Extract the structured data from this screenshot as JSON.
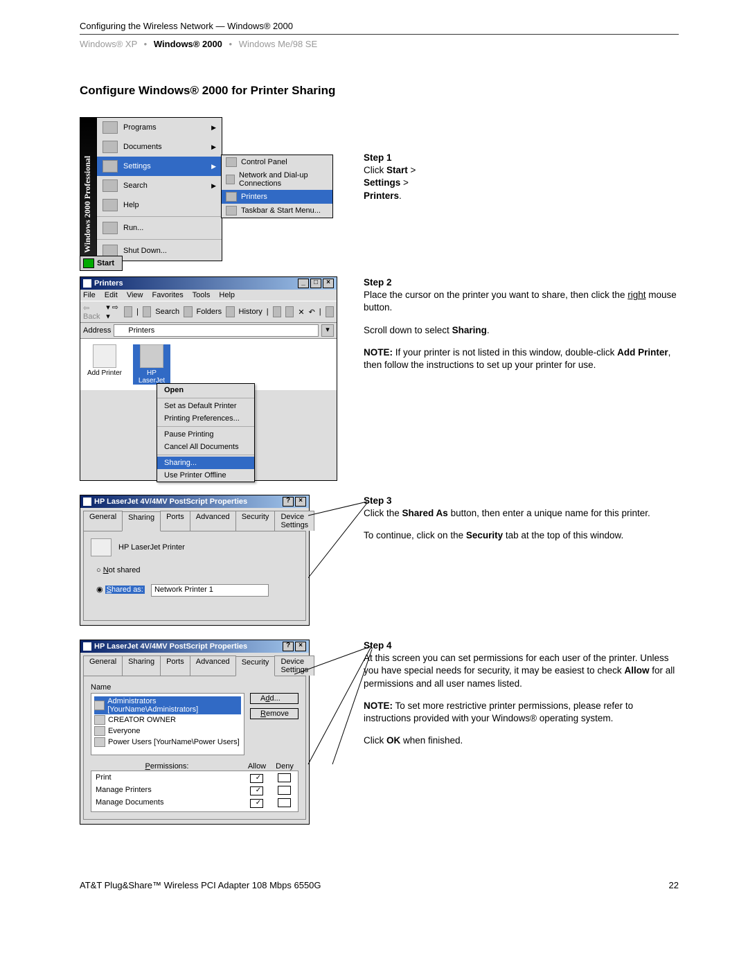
{
  "header": {
    "breadcrumb": "Configuring the Wireless Network — Windows® 2000",
    "tabs": {
      "xp": "Windows® XP",
      "w2000": "Windows® 2000",
      "me98": "Windows Me/98 SE"
    }
  },
  "title": "Configure Windows® 2000 for Printer Sharing",
  "start_menu": {
    "sidebar": "Windows 2000 Professional",
    "items": [
      "Programs",
      "Documents",
      "Settings",
      "Search",
      "Help",
      "Run...",
      "Shut Down..."
    ],
    "start_label": "Start",
    "submenu": [
      "Control Panel",
      "Network and Dial-up Connections",
      "Printers",
      "Taskbar & Start Menu..."
    ]
  },
  "step1": {
    "title": "Step 1",
    "click": "Click ",
    "start": "Start",
    "gt1": " > ",
    "settings": "Settings",
    "gt2": " > ",
    "printers": "Printers",
    "dot": "."
  },
  "printers_window": {
    "title": "Printers",
    "menus": [
      "File",
      "Edit",
      "View",
      "Favorites",
      "Tools",
      "Help"
    ],
    "toolbar": {
      "back": "Back",
      "search": "Search",
      "folders": "Folders",
      "history": "History"
    },
    "address_label": "Address",
    "address_value": "Printers",
    "icons": {
      "add": "Add Printer",
      "hp": "HP LaserJet"
    },
    "context": [
      "Open",
      "Set as Default Printer",
      "Printing Preferences...",
      "Pause Printing",
      "Cancel All Documents",
      "Sharing...",
      "Use Printer Offline"
    ]
  },
  "step2": {
    "title": "Step 2",
    "p1a": "Place the cursor on the printer you want to share, then click the ",
    "right": "right",
    "p1b": " mouse button.",
    "p2a": "Scroll down to select ",
    "sharing": "Sharing",
    "p2b": ".",
    "note_label": "NOTE:",
    "note_a": " If your printer is not listed in this window, double-click ",
    "addp": "Add Printer",
    "note_b": ", then follow the instructions to set up your printer for use."
  },
  "props": {
    "title": "HP LaserJet 4V/4MV PostScript Properties",
    "tabs": [
      "General",
      "Sharing",
      "Ports",
      "Advanced",
      "Security",
      "Device Settings"
    ],
    "printer_name": "HP LaserJet Printer",
    "not_shared": "Not shared",
    "shared_as": "Shared as:",
    "share_value": "Network Printer 1"
  },
  "step3": {
    "title": "Step 3",
    "p1a": "Click the ",
    "sharedas": "Shared As",
    "p1b": " button, then enter a unique name for this printer.",
    "p2a": "To continue, click on the ",
    "sec": "Security",
    "p2b": " tab at the top of this window."
  },
  "security": {
    "name_h": "Name",
    "add": "Add...",
    "remove": "Remove",
    "users": [
      "Administrators [YourName\\Administrators]",
      "CREATOR OWNER",
      "Everyone",
      "Power Users [YourName\\Power Users]"
    ],
    "perm_label": "Permissions:",
    "allow": "Allow",
    "deny": "Deny",
    "perms": [
      "Print",
      "Manage Printers",
      "Manage Documents"
    ]
  },
  "step4": {
    "title": "Step 4",
    "p1a": "At this screen you can set permissions for each user of the printer. Unless you have special needs for security, it may be easiest to check ",
    "allow": "Allow",
    "p1b": " for all permissions and all user names listed.",
    "note_label": "NOTE:",
    "note": " To set more restrictive printer permissions, please refer to instructions provided with your Windows® operating system.",
    "p3a": "Click ",
    "ok": "OK",
    "p3b": " when finished."
  },
  "footer": {
    "left": "AT&T Plug&Share™ Wireless PCI Adapter 108 Mbps 6550G",
    "right": "22"
  }
}
